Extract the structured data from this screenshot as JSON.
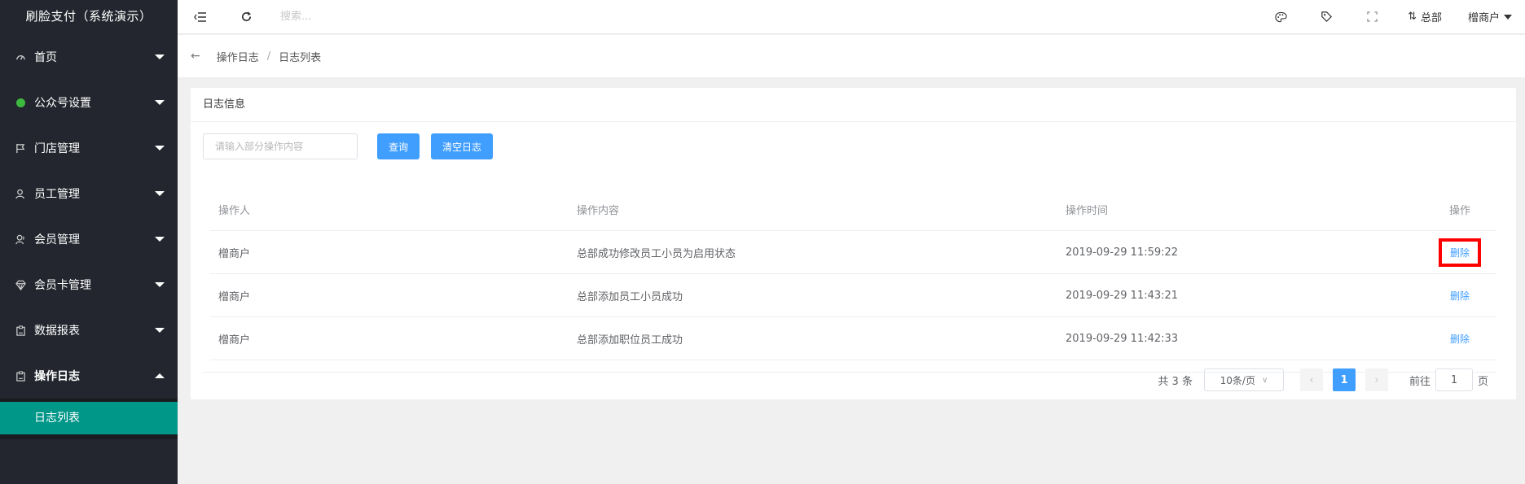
{
  "app": {
    "title": "刷脸支付（系统演示）"
  },
  "sidebar": {
    "items": [
      {
        "label": "首页",
        "icon": "dashboard-icon"
      },
      {
        "label": "公众号设置",
        "icon": "wechat-icon"
      },
      {
        "label": "门店管理",
        "icon": "flag-icon"
      },
      {
        "label": "员工管理",
        "icon": "user-icon"
      },
      {
        "label": "会员管理",
        "icon": "users-icon"
      },
      {
        "label": "会员卡管理",
        "icon": "diamond-icon"
      },
      {
        "label": "数据报表",
        "icon": "report-icon"
      },
      {
        "label": "操作日志",
        "icon": "log-icon"
      }
    ],
    "submenu": [
      {
        "label": "日志列表"
      }
    ]
  },
  "header": {
    "search_placeholder": "搜索...",
    "branch_label": "总部",
    "user_label": "橧商户"
  },
  "breadcrumb": {
    "items": [
      "操作日志",
      "日志列表"
    ],
    "separator": "/"
  },
  "card": {
    "title": "日志信息",
    "filter_placeholder": "请输入部分操作内容",
    "query_label": "查询",
    "clear_label": "清空日志"
  },
  "table": {
    "headers": [
      "操作人",
      "操作内容",
      "操作时间",
      "操作"
    ],
    "rows": [
      {
        "operator": "橧商户",
        "content": "总部成功修改员工小员为启用状态",
        "time": "2019-09-29 11:59:22",
        "action": "删除"
      },
      {
        "operator": "橧商户",
        "content": "总部添加员工小员成功",
        "time": "2019-09-29 11:43:21",
        "action": "删除"
      },
      {
        "operator": "橧商户",
        "content": "总部添加职位员工成功",
        "time": "2019-09-29 11:42:33",
        "action": "删除"
      }
    ]
  },
  "pagination": {
    "total": "共 3 条",
    "page_size": "10条/页",
    "prev": "‹",
    "current": "1",
    "next": "›",
    "goto_prefix": "前往",
    "goto_value": "1",
    "goto_suffix": "页"
  },
  "colors": {
    "sidebar_bg": "#23262e",
    "active_submenu": "#009688",
    "primary": "#409eff",
    "highlight_box": "#ff0000"
  }
}
